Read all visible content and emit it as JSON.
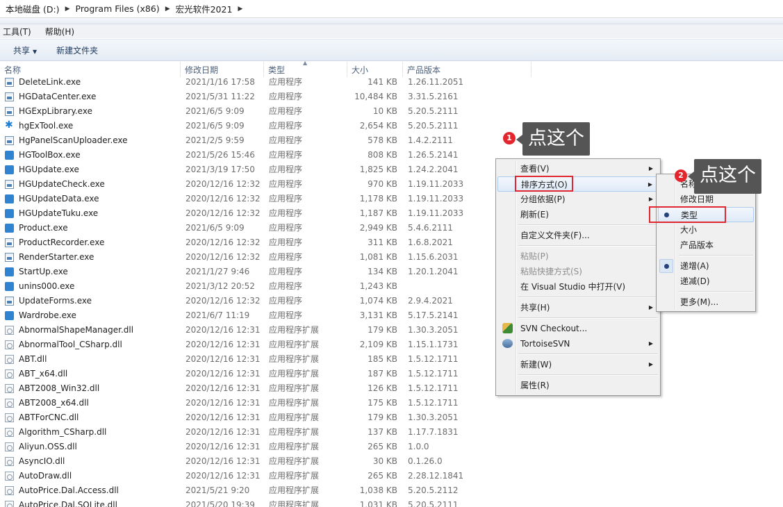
{
  "breadcrumb": [
    "本地磁盘 (D:)",
    "Program Files (x86)",
    "宏光软件2021"
  ],
  "menubar": [
    "工具(T)",
    "帮助(H)"
  ],
  "toolbar": {
    "share": "共享",
    "new_folder": "新建文件夹"
  },
  "columns": {
    "name": "名称",
    "date": "修改日期",
    "type": "类型",
    "size": "大小",
    "version": "产品版本"
  },
  "files": [
    {
      "name": "DeleteLink.exe",
      "date": "2021/1/16 17:58",
      "type": "应用程序",
      "size": "141 KB",
      "version": "1.26.11.2051",
      "icon": "exe-icon"
    },
    {
      "name": "HGDataCenter.exe",
      "date": "2021/5/31 11:22",
      "type": "应用程序",
      "size": "10,484 KB",
      "version": "3.31.5.2161",
      "icon": "exe-icon"
    },
    {
      "name": "HGExpLibrary.exe",
      "date": "2021/6/5 9:09",
      "type": "应用程序",
      "size": "10 KB",
      "version": "5.20.5.2111",
      "icon": "exe-icon"
    },
    {
      "name": "hgExTool.exe",
      "date": "2021/6/5 9:09",
      "type": "应用程序",
      "size": "2,654 KB",
      "version": "5.20.5.2111",
      "icon": "gear-icon"
    },
    {
      "name": "HgPanelScanUploader.exe",
      "date": "2021/2/5 9:59",
      "type": "应用程序",
      "size": "578 KB",
      "version": "1.4.2.2111",
      "icon": "exe-icon"
    },
    {
      "name": "HGToolBox.exe",
      "date": "2021/5/26 15:46",
      "type": "应用程序",
      "size": "808 KB",
      "version": "1.26.5.2141",
      "icon": "app-icon"
    },
    {
      "name": "HGUpdate.exe",
      "date": "2021/3/19 17:50",
      "type": "应用程序",
      "size": "1,825 KB",
      "version": "1.24.2.2041",
      "icon": "app-icon"
    },
    {
      "name": "HGUpdateCheck.exe",
      "date": "2020/12/16 12:32",
      "type": "应用程序",
      "size": "970 KB",
      "version": "1.19.11.2033",
      "icon": "exe-icon"
    },
    {
      "name": "HGUpdateData.exe",
      "date": "2020/12/16 12:32",
      "type": "应用程序",
      "size": "1,178 KB",
      "version": "1.19.11.2033",
      "icon": "app-icon"
    },
    {
      "name": "HGUpdateTuku.exe",
      "date": "2020/12/16 12:32",
      "type": "应用程序",
      "size": "1,187 KB",
      "version": "1.19.11.2033",
      "icon": "app-icon"
    },
    {
      "name": "Product.exe",
      "date": "2021/6/5 9:09",
      "type": "应用程序",
      "size": "2,949 KB",
      "version": "5.4.6.2111",
      "icon": "app-icon"
    },
    {
      "name": "ProductRecorder.exe",
      "date": "2020/12/16 12:32",
      "type": "应用程序",
      "size": "311 KB",
      "version": "1.6.8.2021",
      "icon": "exe-icon"
    },
    {
      "name": "RenderStarter.exe",
      "date": "2020/12/16 12:32",
      "type": "应用程序",
      "size": "1,081 KB",
      "version": "1.15.6.2031",
      "icon": "exe-icon"
    },
    {
      "name": "StartUp.exe",
      "date": "2021/1/27 9:46",
      "type": "应用程序",
      "size": "134 KB",
      "version": "1.20.1.2041",
      "icon": "app-icon"
    },
    {
      "name": "unins000.exe",
      "date": "2021/3/12 20:52",
      "type": "应用程序",
      "size": "1,243 KB",
      "version": "",
      "icon": "app-icon"
    },
    {
      "name": "UpdateForms.exe",
      "date": "2020/12/16 12:32",
      "type": "应用程序",
      "size": "1,074 KB",
      "version": "2.9.4.2021",
      "icon": "exe-icon"
    },
    {
      "name": "Wardrobe.exe",
      "date": "2021/6/7 11:19",
      "type": "应用程序",
      "size": "3,131 KB",
      "version": "5.17.5.2141",
      "icon": "app-icon"
    },
    {
      "name": "AbnormalShapeManager.dll",
      "date": "2020/12/16 12:31",
      "type": "应用程序扩展",
      "size": "179 KB",
      "version": "1.30.3.2051",
      "icon": "dll-icon"
    },
    {
      "name": "AbnormalTool_CSharp.dll",
      "date": "2020/12/16 12:31",
      "type": "应用程序扩展",
      "size": "2,109 KB",
      "version": "1.15.1.1731",
      "icon": "dll-icon"
    },
    {
      "name": "ABT.dll",
      "date": "2020/12/16 12:31",
      "type": "应用程序扩展",
      "size": "185 KB",
      "version": "1.5.12.1711",
      "icon": "dll-icon"
    },
    {
      "name": "ABT_x64.dll",
      "date": "2020/12/16 12:31",
      "type": "应用程序扩展",
      "size": "187 KB",
      "version": "1.5.12.1711",
      "icon": "dll-icon"
    },
    {
      "name": "ABT2008_Win32.dll",
      "date": "2020/12/16 12:31",
      "type": "应用程序扩展",
      "size": "126 KB",
      "version": "1.5.12.1711",
      "icon": "dll-icon"
    },
    {
      "name": "ABT2008_x64.dll",
      "date": "2020/12/16 12:31",
      "type": "应用程序扩展",
      "size": "175 KB",
      "version": "1.5.12.1711",
      "icon": "dll-icon"
    },
    {
      "name": "ABTForCNC.dll",
      "date": "2020/12/16 12:31",
      "type": "应用程序扩展",
      "size": "179 KB",
      "version": "1.30.3.2051",
      "icon": "dll-icon"
    },
    {
      "name": "Algorithm_CSharp.dll",
      "date": "2020/12/16 12:31",
      "type": "应用程序扩展",
      "size": "137 KB",
      "version": "1.17.7.1831",
      "icon": "dll-icon"
    },
    {
      "name": "Aliyun.OSS.dll",
      "date": "2020/12/16 12:31",
      "type": "应用程序扩展",
      "size": "265 KB",
      "version": "1.0.0",
      "icon": "dll-icon"
    },
    {
      "name": "AsyncIO.dll",
      "date": "2020/12/16 12:31",
      "type": "应用程序扩展",
      "size": "30 KB",
      "version": "0.1.26.0",
      "icon": "dll-icon"
    },
    {
      "name": "AutoDraw.dll",
      "date": "2020/12/16 12:31",
      "type": "应用程序扩展",
      "size": "265 KB",
      "version": "2.28.12.1841",
      "icon": "dll-icon"
    },
    {
      "name": "AutoPrice.Dal.Access.dll",
      "date": "2021/5/21 9:20",
      "type": "应用程序扩展",
      "size": "1,038 KB",
      "version": "5.20.5.2112",
      "icon": "dll-icon"
    },
    {
      "name": "AutoPrice.Dal.SQLite.dll",
      "date": "2021/5/20 19:39",
      "type": "应用程序扩展",
      "size": "1,031 KB",
      "version": "5.20.5.2111",
      "icon": "dll-icon"
    }
  ],
  "context_menu": {
    "view": "查看(V)",
    "sort_by": "排序方式(O)",
    "group_by": "分组依据(P)",
    "refresh": "刷新(E)",
    "customize": "自定义文件夹(F)...",
    "paste": "粘贴(P)",
    "paste_shortcut": "粘贴快捷方式(S)",
    "open_vs": "在 Visual Studio 中打开(V)",
    "share": "共享(H)",
    "svn_checkout": "SVN Checkout...",
    "tortoise": "TortoiseSVN",
    "new": "新建(W)",
    "properties": "属性(R)"
  },
  "sort_submenu": {
    "name": "名称",
    "date": "修改日期",
    "type": "类型",
    "size": "大小",
    "version": "产品版本",
    "ascending": "递增(A)",
    "descending": "递减(D)",
    "more": "更多(M)..."
  },
  "callouts": {
    "step1_num": "1",
    "step1_text": "点这个",
    "step2_num": "2",
    "step2_text": "点这个"
  },
  "colors": {
    "highlight_box": "#e0262f",
    "callout_bg": "#555555",
    "badge": "#e3262e"
  }
}
